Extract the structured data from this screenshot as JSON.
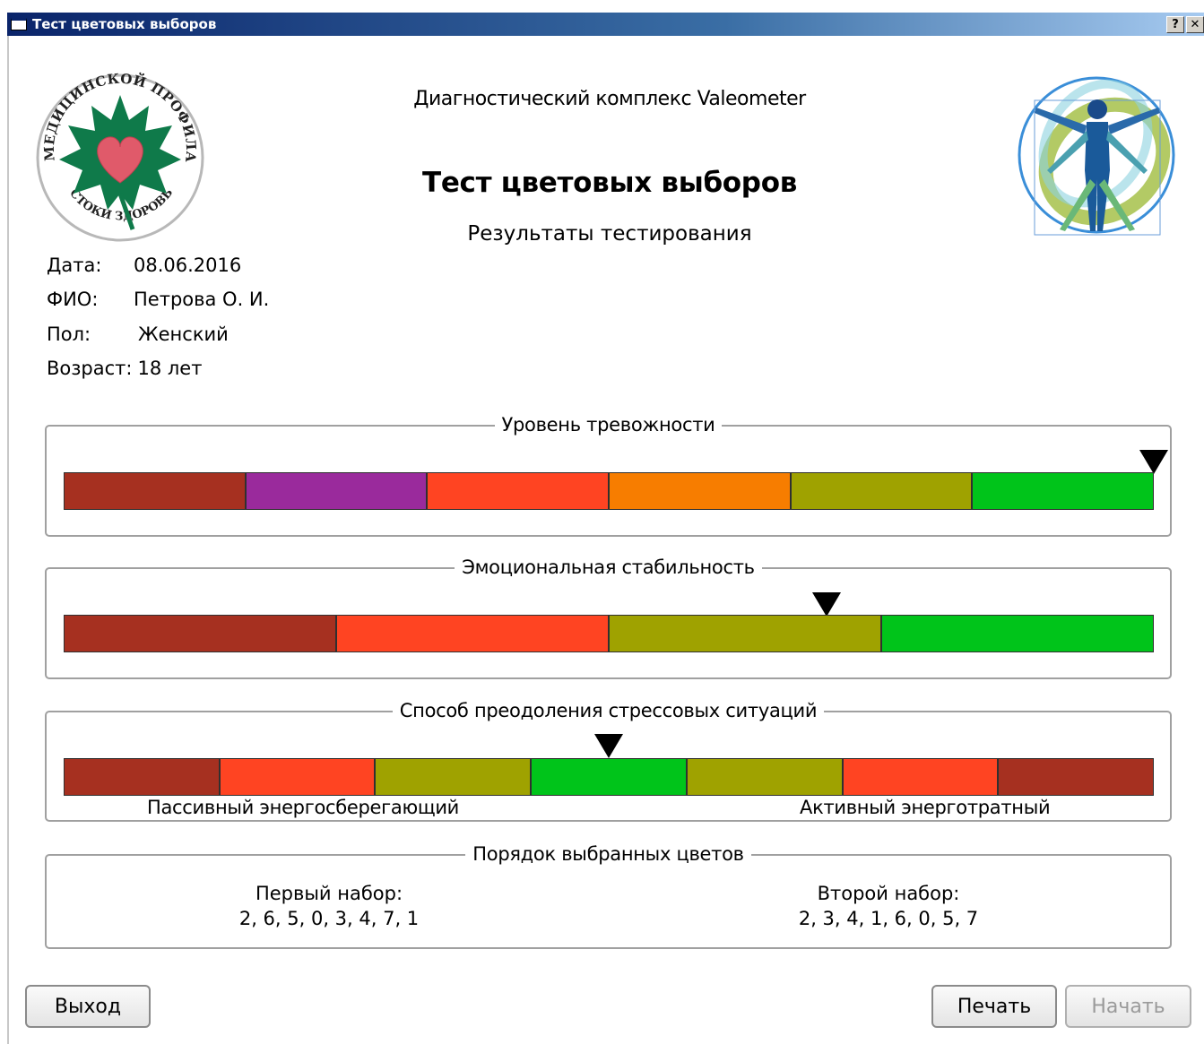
{
  "window": {
    "title": "Тест цветовых выборов",
    "help_label": "?",
    "close_label": "✕"
  },
  "logo_left": {
    "ring_text": "ЦЕНТР МЕДИЦИНСКОЙ ПРОФИЛАКТИКИ",
    "bottom_text": "«ИСТОКИ ЗДОРОВЬЯ»"
  },
  "header": {
    "subtitle": "Диагностический комплекс Valeometer",
    "title": "Тест цветовых выборов",
    "results": "Результаты тестирования"
  },
  "patient": {
    "date_label": "Дата:",
    "date_value": "08.06.2016",
    "name_label": "ФИО:",
    "name_value": "Петрова О. И.",
    "sex_label": "Пол:",
    "sex_value": "Женский",
    "age_label": "Возраст:",
    "age_value": "18 лет"
  },
  "anxiety": {
    "label": "Уровень тревожности",
    "segments": [
      "#a63020",
      "#9a2a9c",
      "#ff4422",
      "#f77d00",
      "#9fa200",
      "#00c41a"
    ],
    "marker_fraction": 1.0
  },
  "stability": {
    "label": "Эмоциональная стабильность",
    "segments": [
      "#a63020",
      "#ff4422",
      "#9fa200",
      "#00c41a"
    ],
    "marker_fraction": 0.7
  },
  "stress": {
    "label": "Способ преодоления стрессовых ситуаций",
    "segments": [
      "#a63020",
      "#ff4422",
      "#9fa200",
      "#00c41a",
      "#9fa200",
      "#ff4422",
      "#a63020"
    ],
    "marker_fraction": 0.5,
    "left_caption": "Пассивный энергосберегающий",
    "right_caption": "Активный энерготратный"
  },
  "colors": {
    "label": "Порядок выбранных цветов",
    "first_label": "Первый набор:",
    "first_value": "2, 6, 5, 0, 3, 4, 7, 1",
    "second_label": "Второй набор:",
    "second_value": "2, 3, 4, 1, 6, 0, 5, 7"
  },
  "buttons": {
    "exit": "Выход",
    "print": "Печать",
    "start": "Начать"
  }
}
